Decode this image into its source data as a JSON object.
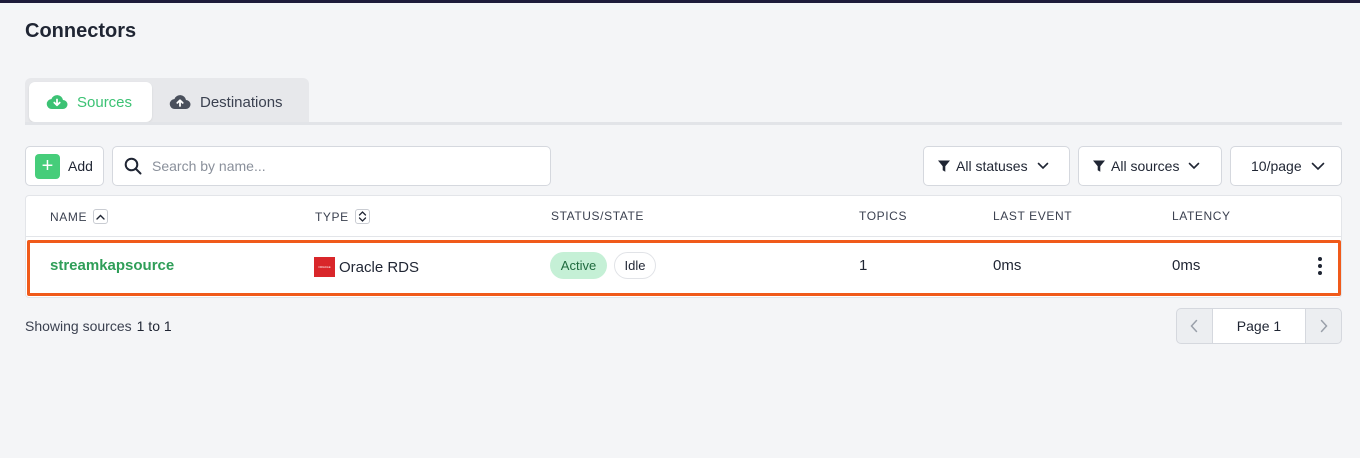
{
  "page": {
    "title": "Connectors"
  },
  "tabs": [
    {
      "label": "Sources",
      "icon": "cloud-download-icon",
      "active": true
    },
    {
      "label": "Destinations",
      "icon": "cloud-upload-icon",
      "active": false
    }
  ],
  "toolbar": {
    "add_label": "Add",
    "search_placeholder": "Search by name...",
    "status_filter": "All statuses",
    "source_filter": "All sources",
    "page_size": "10/page"
  },
  "table": {
    "headers": {
      "name": "NAME",
      "type": "TYPE",
      "status": "STATUS/STATE",
      "topics": "TOPICS",
      "last_event": "LAST EVENT",
      "latency": "LATENCY"
    },
    "rows": [
      {
        "name": "streamkapsource",
        "type": "Oracle RDS",
        "type_logo_text": "ORACLE",
        "status": "Active",
        "state": "Idle",
        "topics": "1",
        "last_event": "0ms",
        "latency": "0ms"
      }
    ]
  },
  "footer": {
    "showing_label": "Showing sources",
    "showing_range": "1 to 1",
    "page_label": "Page 1"
  },
  "colors": {
    "accent_green": "#3cc274",
    "highlight_orange": "#f05a1a",
    "oracle_red": "#d9262a"
  }
}
